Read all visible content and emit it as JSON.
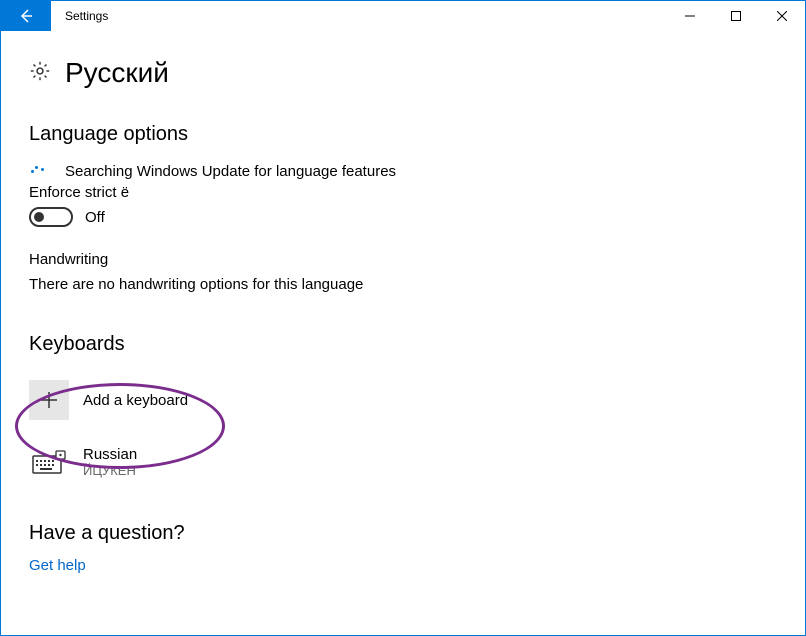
{
  "window": {
    "title": "Settings"
  },
  "page": {
    "title": "Русский",
    "language_options_label": "Language options",
    "status": "Searching Windows Update for language features",
    "enforce_strict_label": "Enforce strict ё",
    "toggle_state": "Off",
    "handwriting_label": "Handwriting",
    "handwriting_text": "There are no handwriting options for this language",
    "keyboards_label": "Keyboards",
    "add_keyboard_label": "Add a keyboard",
    "keyboard": {
      "name": "Russian",
      "layout": "ЙЦУКЕН"
    },
    "question_label": "Have a question?",
    "help_link": "Get help"
  }
}
